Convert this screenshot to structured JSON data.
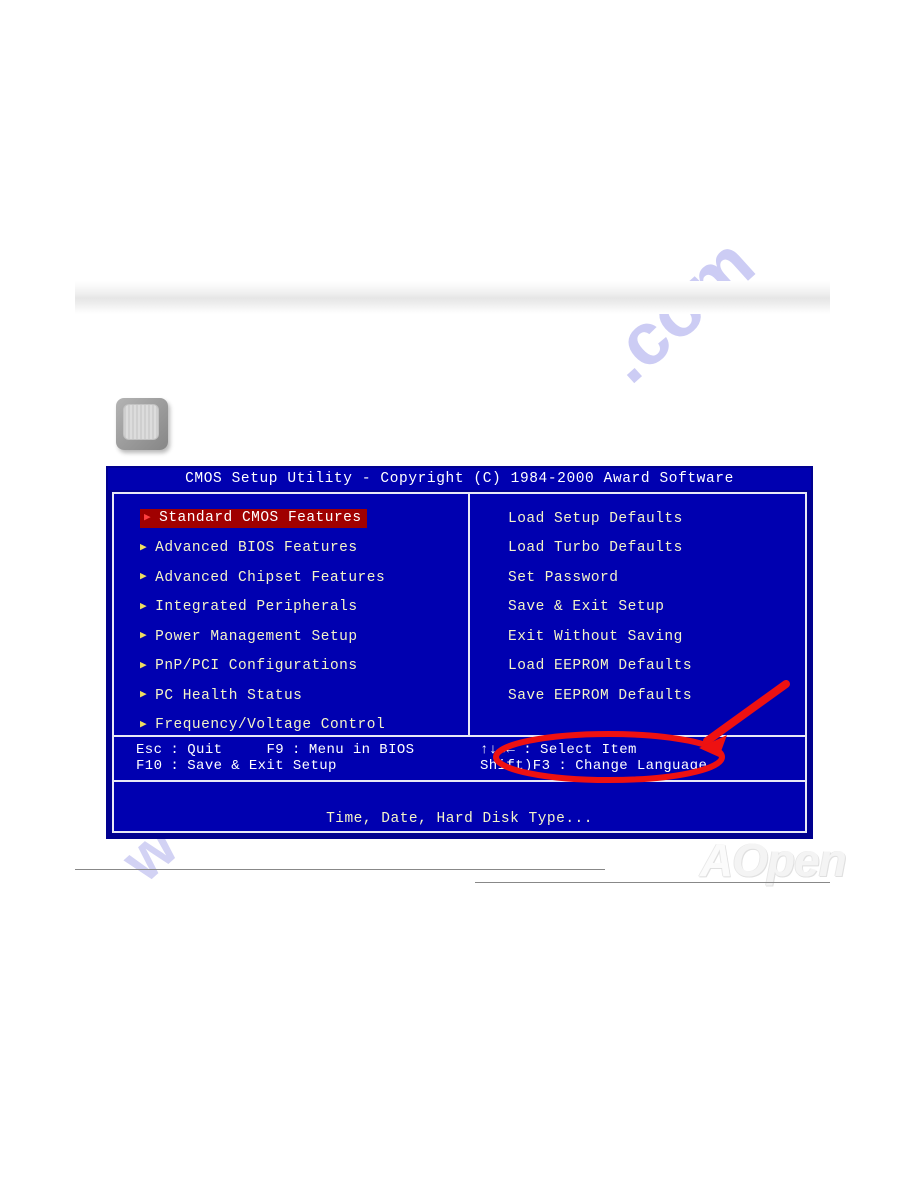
{
  "watermarks": {
    "com": ".com",
    "bottom": "w"
  },
  "key_icon": {
    "name": "keyboard-key-icon"
  },
  "bios": {
    "title": "CMOS Setup Utility - Copyright (C) 1984-2000 Award Software",
    "left_menu": [
      {
        "label": "Standard CMOS Features",
        "selected": true
      },
      {
        "label": "Advanced BIOS Features",
        "selected": false
      },
      {
        "label": "Advanced Chipset Features",
        "selected": false
      },
      {
        "label": "Integrated Peripherals",
        "selected": false
      },
      {
        "label": "Power Management Setup",
        "selected": false
      },
      {
        "label": "PnP/PCI Configurations",
        "selected": false
      },
      {
        "label": "PC Health Status",
        "selected": false
      },
      {
        "label": "Frequency/Voltage Control",
        "selected": false
      }
    ],
    "right_menu": [
      {
        "label": "Load Setup Defaults"
      },
      {
        "label": "Load Turbo Defaults"
      },
      {
        "label": "Set Password"
      },
      {
        "label": "Save & Exit Setup"
      },
      {
        "label": "Exit Without Saving"
      },
      {
        "label": "Load EEPROM Defaults"
      },
      {
        "label": "Save EEPROM Defaults"
      }
    ],
    "hints": {
      "esc_key": "Esc",
      "esc_action": "Quit",
      "f9_key": "F9",
      "f9_action": "Menu in BIOS",
      "f10_key": "F10",
      "f10_action": "Save & Exit Setup",
      "arrows_key": "↑↓→←",
      "arrows_action": "Select Item",
      "shift_f3_key": "Shift)F3",
      "shift_f3_action": "Change Language",
      "separator": ":"
    },
    "footer_note": "Time, Date, Hard Disk Type..."
  },
  "annotation": {
    "ellipse_label": "highlight-ellipse",
    "arrow_label": "callout-arrow",
    "color": "#ee1111"
  },
  "logo": {
    "mark": "A",
    "text": "Open"
  }
}
